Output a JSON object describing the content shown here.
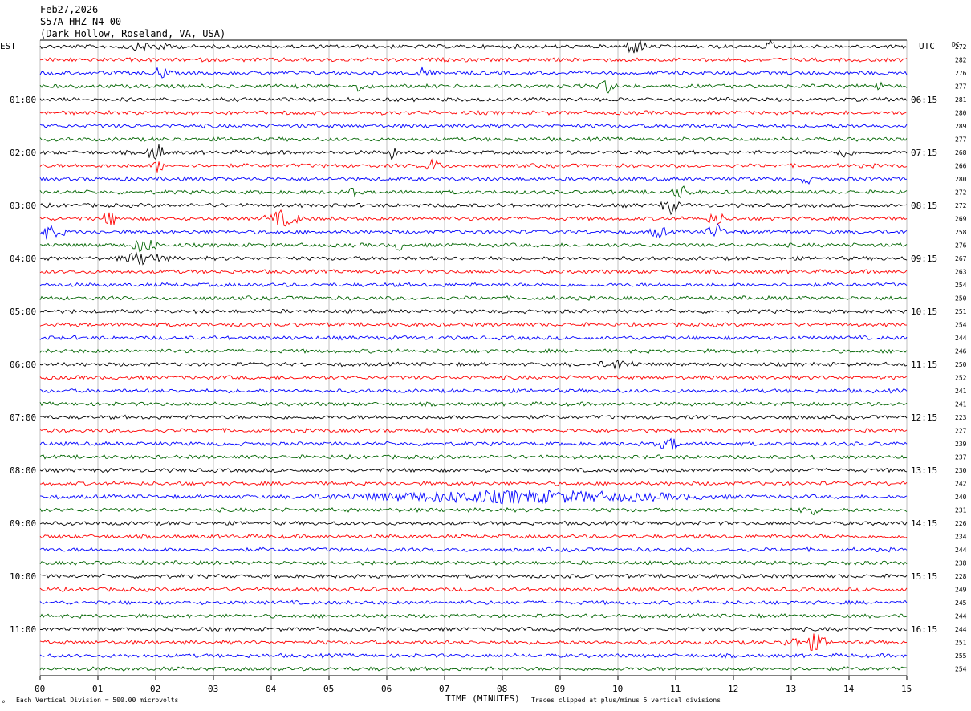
{
  "header": {
    "date": "Feb27,2026",
    "station": "S57A HHZ N4 00",
    "location": "(Dark Hollow, Roseland, VA, USA)"
  },
  "left_axis_title": "EST",
  "right_axis_title": "UTC",
  "dc_title": "DC",
  "footer": {
    "note_left": "Each Vertical Division =  500.00 microvolts",
    "note_right": "Traces clipped at plus/minus 5 vertical divisions",
    "mark": "⌕"
  },
  "chart_data": {
    "type": "line",
    "title": "",
    "xlabel": "TIME (MINUTES)",
    "ylabel": "",
    "xlim": [
      0,
      15
    ],
    "x_ticks": [
      "00",
      "01",
      "02",
      "03",
      "04",
      "05",
      "06",
      "07",
      "08",
      "09",
      "10",
      "11",
      "12",
      "13",
      "14",
      "15"
    ],
    "trace_count": 48,
    "trace_colors": [
      "#000000",
      "#ff0000",
      "#0000ff",
      "#006400"
    ],
    "left_time_labels": [
      {
        "trace": 4,
        "label": "01:00"
      },
      {
        "trace": 8,
        "label": "02:00"
      },
      {
        "trace": 12,
        "label": "03:00"
      },
      {
        "trace": 16,
        "label": "04:00"
      },
      {
        "trace": 20,
        "label": "05:00"
      },
      {
        "trace": 24,
        "label": "06:00"
      },
      {
        "trace": 28,
        "label": "07:00"
      },
      {
        "trace": 32,
        "label": "08:00"
      },
      {
        "trace": 36,
        "label": "09:00"
      },
      {
        "trace": 40,
        "label": "10:00"
      },
      {
        "trace": 44,
        "label": "11:00"
      }
    ],
    "right_time_labels": [
      {
        "trace": 4,
        "label": "06:15"
      },
      {
        "trace": 8,
        "label": "07:15"
      },
      {
        "trace": 12,
        "label": "08:15"
      },
      {
        "trace": 16,
        "label": "09:15"
      },
      {
        "trace": 20,
        "label": "10:15"
      },
      {
        "trace": 24,
        "label": "11:15"
      },
      {
        "trace": 28,
        "label": "12:15"
      },
      {
        "trace": 32,
        "label": "13:15"
      },
      {
        "trace": 36,
        "label": "14:15"
      },
      {
        "trace": 40,
        "label": "15:15"
      },
      {
        "trace": 44,
        "label": "16:15"
      }
    ],
    "dc_offsets": [
      272,
      282,
      276,
      277,
      281,
      280,
      289,
      277,
      268,
      266,
      280,
      272,
      272,
      269,
      258,
      276,
      267,
      263,
      254,
      250,
      251,
      254,
      244,
      246,
      250,
      252,
      241,
      241,
      223,
      227,
      239,
      237,
      230,
      242,
      240,
      231,
      226,
      234,
      244,
      238,
      228,
      249,
      245,
      244,
      244,
      251,
      255,
      254
    ]
  }
}
